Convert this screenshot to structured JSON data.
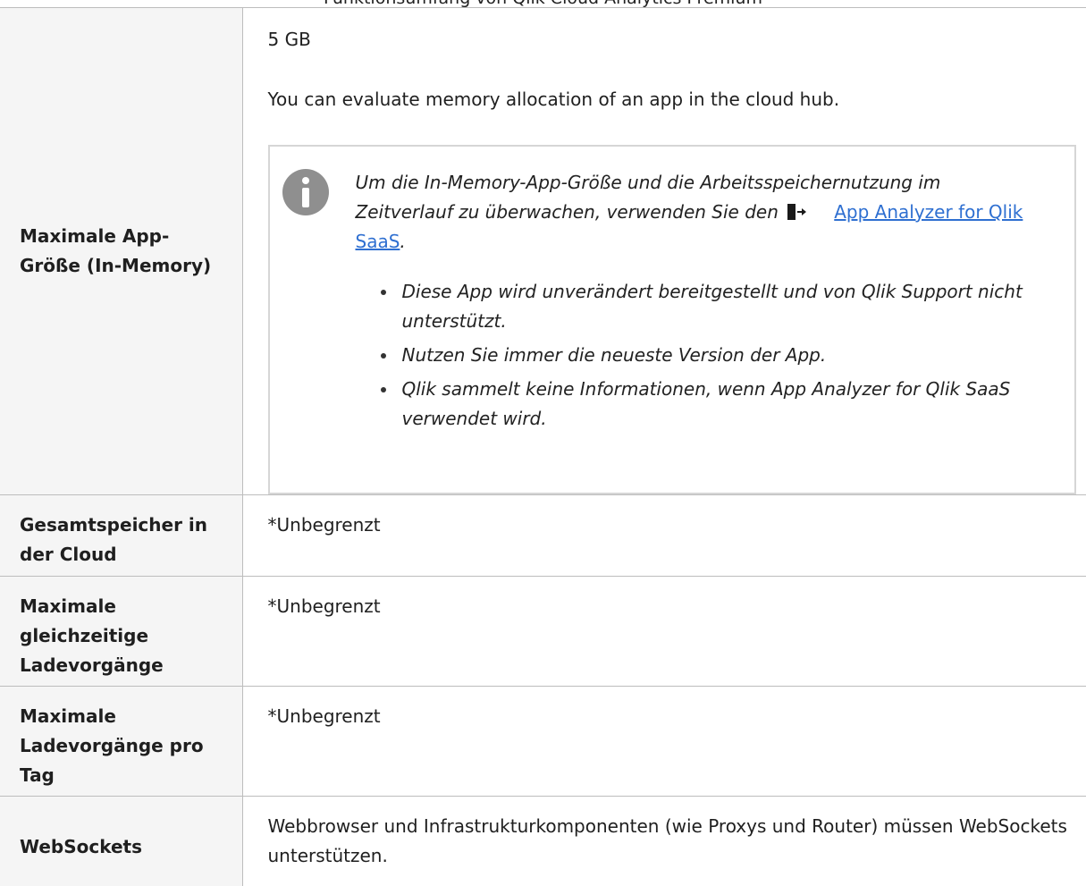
{
  "top_fragment": "Funktionsumfang von Qlik Cloud Analytics Premium",
  "rows": [
    {
      "label": "Maximale App-Größe (In-Memory)",
      "value": "5 GB",
      "note_text": "You can evaluate memory allocation of an app in the cloud hub.",
      "info": {
        "text": "Um die In-Memory-App-Größe und die Arbeitsspeichernutzung im Zeitverlauf zu überwachen, verwenden Sie den",
        "icon": "external-link-icon",
        "link_text": "App Analyzer for Qlik SaaS",
        "after_link": ".",
        "bullets": [
          "Diese App wird unverändert bereitgestellt und von Qlik Support nicht unterstützt.",
          "Nutzen Sie immer die neueste Version der App.",
          "Qlik sammelt keine Informationen, wenn App Analyzer for Qlik SaaS verwendet wird."
        ]
      }
    },
    {
      "label": "Gesamtspeicher in der Cloud",
      "value": "*Unbegrenzt"
    },
    {
      "label": "Maximale gleichzeitige Ladevorgänge",
      "value": "*Unbegrenzt"
    },
    {
      "label": "Maximale Ladevorgänge pro Tag",
      "value": "*Unbegrenzt"
    },
    {
      "label": "WebSockets",
      "value": "Webbrowser und Infrastrukturkomponenten (wie Proxys und Router) müssen WebSockets unterstützen."
    }
  ],
  "colors": {
    "link": "#2e6fd1",
    "label_bg": "#f5f5f5",
    "border": "#bdbdbd",
    "info_icon": "#8f8f8f"
  }
}
